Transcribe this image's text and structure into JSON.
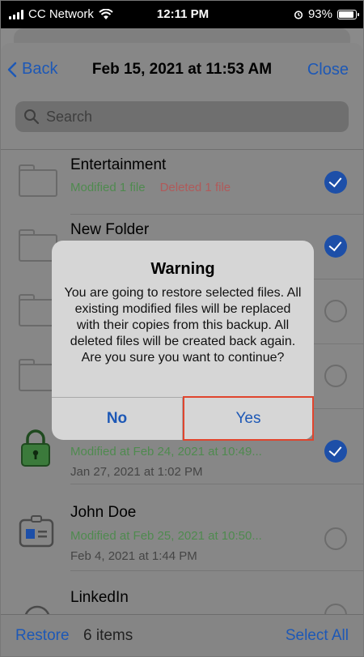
{
  "status_bar": {
    "carrier": "CC Network",
    "time": "12:11 PM",
    "battery": "93%"
  },
  "nav": {
    "back_label": "Back",
    "title": "Feb 15, 2021 at 11:53 AM",
    "close_label": "Close"
  },
  "search": {
    "placeholder": "Search"
  },
  "rows": [
    {
      "title": "Entertainment",
      "sub1": "Modified 1 file",
      "sub1_deleted": "Deleted 1 file",
      "sub2": "",
      "checked": true,
      "icon": "folder-icon"
    },
    {
      "title": "New Folder",
      "sub1": "",
      "sub1_deleted": "",
      "sub2": "",
      "checked": true,
      "icon": "folder-icon"
    },
    {
      "title": "",
      "sub1": "",
      "sub1_deleted": "",
      "sub2": "",
      "checked": false,
      "icon": "folder-icon"
    },
    {
      "title": "",
      "sub1": "",
      "sub1_deleted": "",
      "sub2": "",
      "checked": false,
      "icon": "folder-icon"
    },
    {
      "title": "",
      "sub1": "Modified at Feb 24, 2021 at 10:49...",
      "sub1_deleted": "",
      "sub2": "Jan 27, 2021 at 1:02 PM",
      "checked": true,
      "icon": "lock-icon"
    },
    {
      "title": "John Doe",
      "sub1": "Modified at Feb 25, 2021 at 10:50...",
      "sub1_deleted": "",
      "sub2": "Feb 4, 2021 at 1:44 PM",
      "checked": false,
      "icon": "contact-card-icon"
    },
    {
      "title": "LinkedIn",
      "sub1": "",
      "sub1_deleted": "",
      "sub2": "",
      "checked": false,
      "icon": "generic-item-icon"
    }
  ],
  "footer": {
    "restore_label": "Restore",
    "count_label": "6 items",
    "select_all_label": "Select All"
  },
  "dialog": {
    "title": "Warning",
    "message": "You are going to restore selected files. All existing modified files will be replaced with their copies from this backup. All deleted files will be created back again. Are you sure you want to continue?",
    "no_label": "No",
    "yes_label": "Yes"
  },
  "colors": {
    "accent": "#1d58b6",
    "modified": "#4f8a4f",
    "deleted": "#b05a5a",
    "highlight": "#e0452e"
  }
}
